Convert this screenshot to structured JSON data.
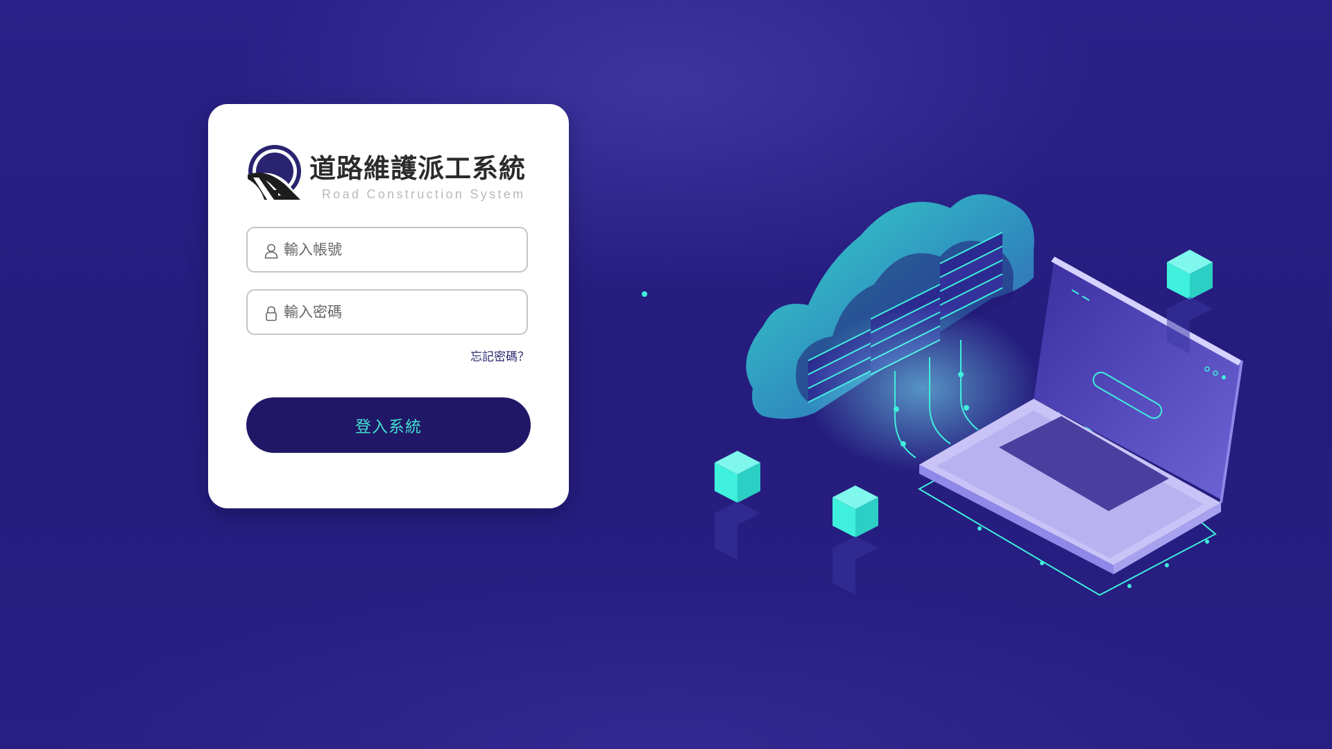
{
  "brand": {
    "title": "道路維護派工系統",
    "subtitle": "Road Construction System",
    "logo_icon": "road-tunnel-logo"
  },
  "login_form": {
    "username": {
      "value": "",
      "placeholder": "輸入帳號",
      "icon": "user-icon"
    },
    "password": {
      "value": "",
      "placeholder": "輸入密碼",
      "icon": "lock-icon"
    },
    "forgot_password_label": "忘記密碼？",
    "login_button_label": "登入系統"
  },
  "colors": {
    "background": "#281f83",
    "card": "#ffffff",
    "primary_button": "#201866",
    "button_text": "#43e0d3",
    "accent_cyan": "#3ff0dc",
    "laptop_lavender": "#b9b2f0"
  },
  "illustration": {
    "description_icon": "cloud-server-laptop-illustration"
  }
}
